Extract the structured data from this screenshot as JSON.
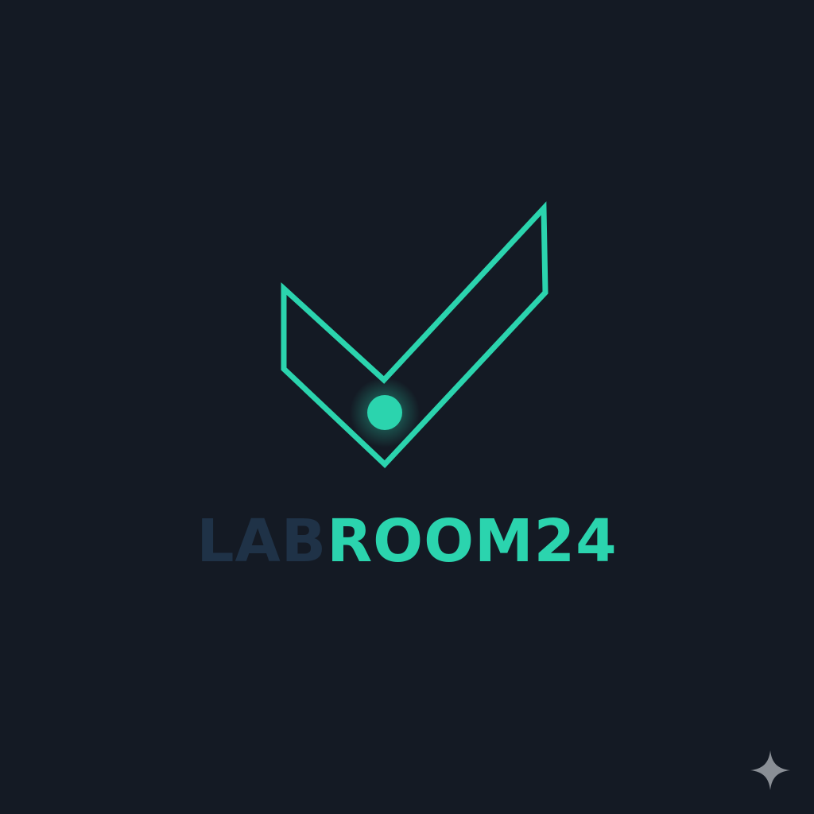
{
  "brand": {
    "name_part_1": "LAB",
    "name_part_2": "ROOM24"
  },
  "colors": {
    "background": "#141a24",
    "accent": "#2bd4ae",
    "muted": "#1f3247",
    "sparkle": "#8a8f96"
  },
  "icons": {
    "logo": "checkmark-with-dot-icon",
    "watermark": "sparkle-icon"
  }
}
